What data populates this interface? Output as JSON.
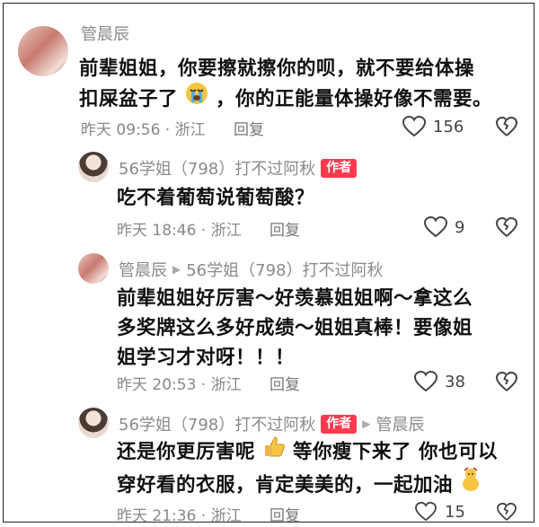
{
  "comments": [
    {
      "author": "管晨辰",
      "text_line1": "前辈姐姐，你要擦就擦你的呗，就不要给体操",
      "text_line2a": "扣屎盆子了",
      "text_line2b": "，你的正能量体操好像不需要。",
      "emoji": "crying-face",
      "time": "昨天 09:56 · 浙江",
      "reply_label": "回复",
      "likes": "156"
    },
    {
      "author": "56学姐（798）打不过阿秋",
      "badge": "作者",
      "text": "吃不着葡萄说葡萄酸？",
      "time": "昨天 18:46 · 浙江",
      "reply_label": "回复",
      "likes": "9"
    },
    {
      "author": "管晨辰",
      "reply_to": "56学姐（798）打不过阿秋",
      "text_line1": "前辈姐姐好厉害～好羡慕姐姐啊～拿这么",
      "text_line2": "多奖牌这么多好成绩～姐姐真棒！要像姐",
      "text_line3": "姐学习才对呀！！！",
      "time": "昨天 20:53 · 浙江",
      "reply_label": "回复",
      "likes": "38"
    },
    {
      "author": "56学姐（798）打不过阿秋",
      "badge": "作者",
      "reply_to": "管晨辰",
      "text_line1a": "还是你更厉害呢",
      "text_line1b": "等你瘦下来了 你也可以",
      "text_line2": "穿好看的衣服，肯定美美的，一起加油",
      "emoji1": "thumbs-up",
      "emoji2": "cheering",
      "time": "昨天 21:36 · 浙江",
      "reply_label": "回复",
      "likes": "15"
    }
  ],
  "colors": {
    "badge": "#ff3a4f",
    "meta": "#888888",
    "text": "#111111"
  }
}
